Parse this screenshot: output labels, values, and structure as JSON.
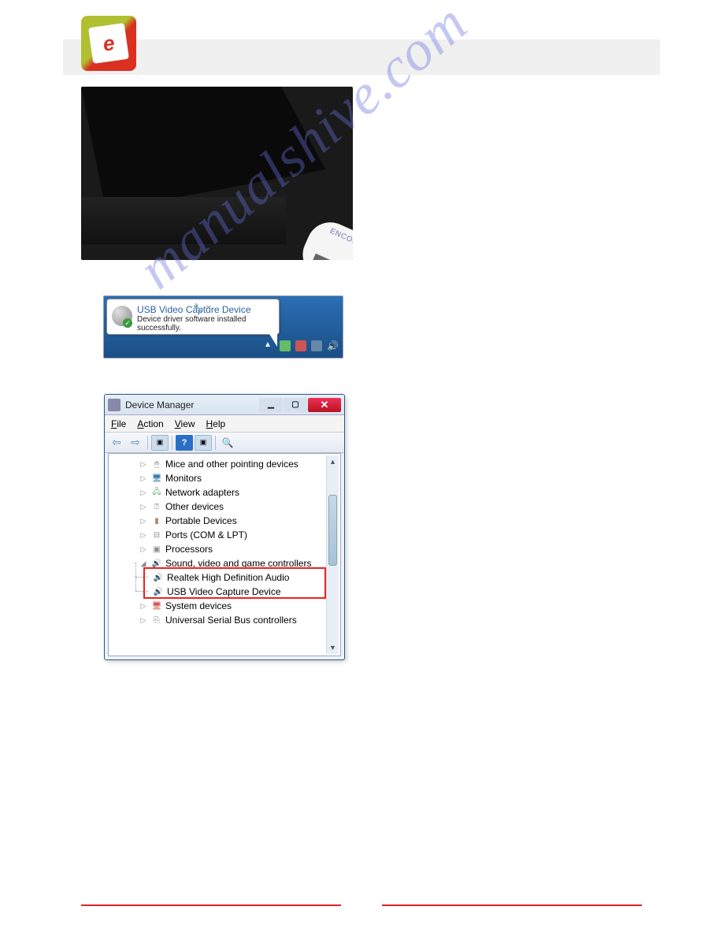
{
  "watermark": "manualshive.com",
  "usb_brand": "ENCORE",
  "balloon": {
    "title": "USB Video Capture Device",
    "subtitle": "Device driver software installed successfully."
  },
  "devmgr": {
    "title": "Device Manager",
    "menu": {
      "file": "File",
      "action": "Action",
      "view": "View",
      "help": "Help"
    },
    "nodes": {
      "mice": "Mice and other pointing devices",
      "monitors": "Monitors",
      "network": "Network adapters",
      "other": "Other devices",
      "portable": "Portable Devices",
      "ports": "Ports (COM & LPT)",
      "processors": "Processors",
      "sound": "Sound, video and game controllers",
      "sound_c1": "Realtek High Definition Audio",
      "sound_c2": "USB Video Capture Device",
      "system": "System devices",
      "usb": "Universal Serial Bus controllers"
    }
  }
}
